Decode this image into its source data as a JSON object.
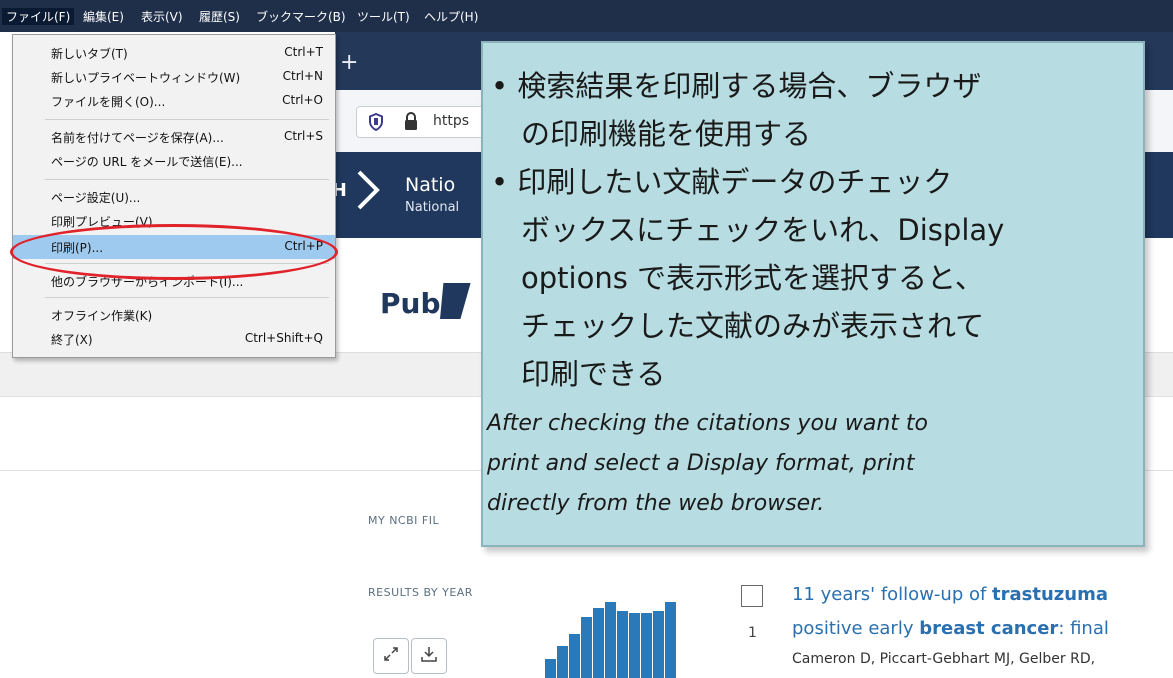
{
  "menubar": {
    "items": [
      "ファイル(F)",
      "編集(E)",
      "表示(V)",
      "履歴(S)",
      "ブックマーク(B)",
      "ツール(T)",
      "ヘルプ(H)"
    ]
  },
  "browser": {
    "url_text": "https",
    "new_tab": "+"
  },
  "file_menu": {
    "items": [
      {
        "label": "新しいタブ(T)",
        "shortcut": "Ctrl+T"
      },
      {
        "label": "新しいプライベートウィンドウ(W)",
        "shortcut": "Ctrl+N"
      },
      {
        "label": "ファイルを開く(O)...",
        "shortcut": "Ctrl+O"
      },
      {
        "label": "名前を付けてページを保存(A)...",
        "shortcut": "Ctrl+S"
      },
      {
        "label": "ページの URL をメールで送信(E)...",
        "shortcut": ""
      },
      {
        "label": "ページ設定(U)...",
        "shortcut": ""
      },
      {
        "label": "印刷プレビュー(V)",
        "shortcut": ""
      },
      {
        "label": "印刷(P)...",
        "shortcut": "Ctrl+P"
      },
      {
        "label": "他のブラウザーからインポート(I)...",
        "shortcut": ""
      },
      {
        "label": "オフライン作業(K)",
        "shortcut": ""
      },
      {
        "label": "終了(X)",
        "shortcut": "Ctrl+Shift+Q"
      }
    ]
  },
  "nih": {
    "logo_text": "NIH",
    "title": "Natio",
    "subtitle": "National"
  },
  "pubmed": {
    "logo_text": "Pub",
    "my_ncbi_label": "MY NCBI FIL",
    "results_by_year_label": "RESULTS BY YEAR",
    "result": {
      "number": "1",
      "title_line1_prefix": "11 years' follow-up of ",
      "title_line1_bold": "trastuzuma",
      "title_line2_prefix": "positive early ",
      "title_line2_bold": "breast cancer",
      "title_line2_suffix": ": final",
      "authors": "Cameron D, Piccart-Gebhart MJ, Gelber RD,"
    },
    "year_bars": [
      0.25,
      0.42,
      0.58,
      0.8,
      0.92,
      1.0,
      0.88,
      0.86,
      0.86,
      0.88,
      1.0
    ]
  },
  "callout": {
    "bullet1_line1": "• 検索結果を印刷する場合、ブラウザ",
    "bullet1_line2": "の印刷機能を使用する",
    "bullet2_line1": "• 印刷したい文献データのチェック",
    "bullet2_line2": "ボックスにチェックをいれ、Display",
    "bullet2_line3": "options で表示形式を選択すると、",
    "bullet2_line4": "チェックした文献のみが表示されて",
    "bullet2_line5": "印刷できる",
    "english_line1": "After checking the citations you want to",
    "english_line2": "print and select a Display format, print",
    "english_line3": "directly from the web browser."
  },
  "colors": {
    "menubar_bg": "#1f2f4a",
    "highlight": "#9fcaf0",
    "annotation_red": "#e0232b",
    "callout_bg": "#b7dde2",
    "nih_blue": "#20385d",
    "link_blue": "#2a6fb0"
  },
  "icons": [
    "shield-icon",
    "lock-icon",
    "expand-icon",
    "download-icon",
    "nih-chevron-icon"
  ]
}
